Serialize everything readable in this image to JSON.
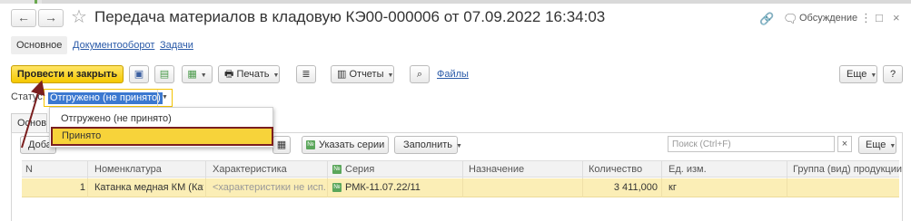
{
  "window": {
    "title": "Передача материалов в кладовую КЭ00-000006 от 07.09.2022 16:34:03",
    "discuss_label": "Обсуждение"
  },
  "tabs": [
    "Основное",
    "Документооборот",
    "Задачи"
  ],
  "toolbar": {
    "post_close_label": "Провести и закрыть",
    "print_label": "Печать",
    "reports_label": "Отчеты",
    "files_label": "Файлы",
    "more_label": "Еще"
  },
  "status": {
    "label": "Статус:",
    "value": "Отгружено (не принято)",
    "options": [
      "Отгружено (не принято)",
      "Принято"
    ]
  },
  "section": {
    "tab_label": "Основное",
    "add_label": "Добавить",
    "specify_series_label": "Указать серии",
    "fill_label": "Заполнить",
    "search_placeholder": "Поиск (Ctrl+F)",
    "more_label": "Еще",
    "series_badge": "№"
  },
  "table": {
    "columns": [
      "N",
      "Номенклатура",
      "Характеристика",
      "Серия",
      "Назначение",
      "Количество",
      "Ед. изм.",
      "Группа (вид) продукции"
    ],
    "rows": [
      {
        "n": "1",
        "nomenclature": "Катанка медная КМ (Кат...",
        "characteristic": "<характеристики не исп...",
        "series": "РМК-11.07.22/11",
        "purpose": "",
        "quantity": "3 411,000",
        "unit": "кг",
        "group": ""
      }
    ]
  },
  "colors": {
    "primary_button": "#f5c800",
    "selection": "#3b78d0",
    "row_highlight": "#fbeeb6",
    "annotation": "#7a1f1f"
  }
}
